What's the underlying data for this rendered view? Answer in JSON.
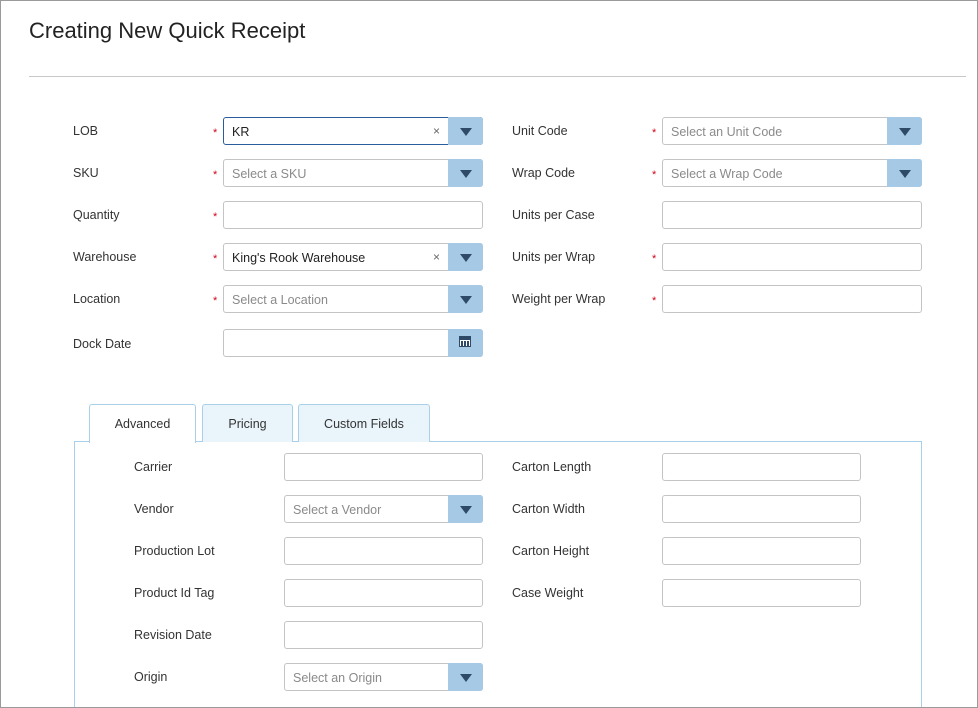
{
  "page": {
    "title": "Creating New Quick Receipt"
  },
  "form": {
    "lob": {
      "label": "LOB",
      "value": "KR",
      "clear": "×"
    },
    "sku": {
      "label": "SKU",
      "placeholder": "Select a SKU"
    },
    "quantity": {
      "label": "Quantity",
      "value": ""
    },
    "warehouse": {
      "label": "Warehouse",
      "value": "King's Rook Warehouse",
      "clear": "×"
    },
    "location": {
      "label": "Location",
      "placeholder": "Select a Location"
    },
    "dock_date": {
      "label": "Dock Date",
      "value": ""
    },
    "unit_code": {
      "label": "Unit Code",
      "placeholder": "Select an Unit Code"
    },
    "wrap_code": {
      "label": "Wrap Code",
      "placeholder": "Select a Wrap Code"
    },
    "units_per_case": {
      "label": "Units per Case",
      "value": ""
    },
    "units_per_wrap": {
      "label": "Units per Wrap",
      "value": ""
    },
    "weight_per_wrap": {
      "label": "Weight per Wrap",
      "value": ""
    },
    "required_mark": "*"
  },
  "tabs": [
    {
      "label": "Advanced",
      "active": true
    },
    {
      "label": "Pricing",
      "active": false
    },
    {
      "label": "Custom Fields",
      "active": false
    }
  ],
  "advanced": {
    "carrier": {
      "label": "Carrier",
      "value": ""
    },
    "vendor": {
      "label": "Vendor",
      "placeholder": "Select a Vendor"
    },
    "production_lot": {
      "label": "Production Lot",
      "value": ""
    },
    "product_id_tag": {
      "label": "Product Id Tag",
      "value": ""
    },
    "revision_date": {
      "label": "Revision Date",
      "value": ""
    },
    "origin": {
      "label": "Origin",
      "placeholder": "Select an Origin"
    },
    "carton_length": {
      "label": "Carton Length",
      "value": ""
    },
    "carton_width": {
      "label": "Carton Width",
      "value": ""
    },
    "carton_height": {
      "label": "Carton Height",
      "value": ""
    },
    "case_weight": {
      "label": "Case Weight",
      "value": ""
    }
  },
  "colors": {
    "dropdown_button": "#a6cae6",
    "required": "#d0021b",
    "tab_border": "#a9d0e8",
    "focus_border": "#2a5d9c"
  }
}
